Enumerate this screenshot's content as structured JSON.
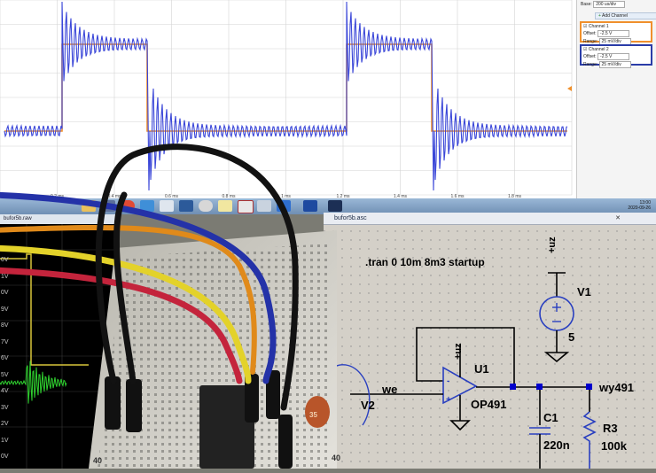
{
  "scope": {
    "x_ticks": [
      "0.2 ms",
      "0.4 ms",
      "0.6 ms",
      "0.8 ms",
      "1 ms",
      "1.2 ms",
      "1.4 ms",
      "1.6 ms",
      "1.8 ms"
    ],
    "colors": {
      "channel1": "#f0902c",
      "channel2": "#3a46d8",
      "grid": "#cfcfcf"
    }
  },
  "scope_panel": {
    "base_label": "Base:",
    "base_value": "200 us/div",
    "add_channel": "Add Channel",
    "channel1": {
      "title": "Channel 1",
      "offset_label": "Offset:",
      "offset_value": "-2.5 V",
      "range_label": "Range:",
      "range_value": "25 mV/div"
    },
    "channel2": {
      "title": "Channel 2",
      "offset_label": "Offset:",
      "offset_value": "-2.5 V",
      "range_label": "Range:",
      "range_value": "25 mV/div"
    }
  },
  "taskbar": {
    "clock_time": "13:00",
    "clock_date": "2020-09-26",
    "icons": [
      "folder-icon",
      "media-icon",
      "browser-icon",
      "explorer-icon",
      "paint-icon",
      "mail-icon",
      "disc-icon",
      "notes-icon",
      "ltspice-icon",
      "calc-icon",
      "word-icon",
      "word2-icon",
      "ps-icon"
    ]
  },
  "left_window": {
    "title": "bufor5b.raw",
    "voltages": [
      "0V",
      "1V",
      "0V",
      "9V",
      "8V",
      "7V",
      "6V",
      "5V",
      "4V",
      "3V",
      "2V",
      "1V",
      "0V"
    ]
  },
  "ltspice": {
    "title": "bufor5b.asc",
    "directive": ".tran 0 10m 8m3 startup",
    "supply_label": "+uz",
    "opamp_supply_label": "+uz",
    "v1_name": "V1",
    "v1_value": "5",
    "v2_name": "V2",
    "u1_name": "U1",
    "u1_model": "OP491",
    "net_in": "we",
    "net_out": "wy491",
    "c1_name": "C1",
    "c1_value": "220n",
    "r3_name": "R3",
    "r3_value": "100k"
  },
  "breadboard": {
    "row_label_left": "40",
    "row_label_right": "40",
    "row_label_mid": "35"
  }
}
